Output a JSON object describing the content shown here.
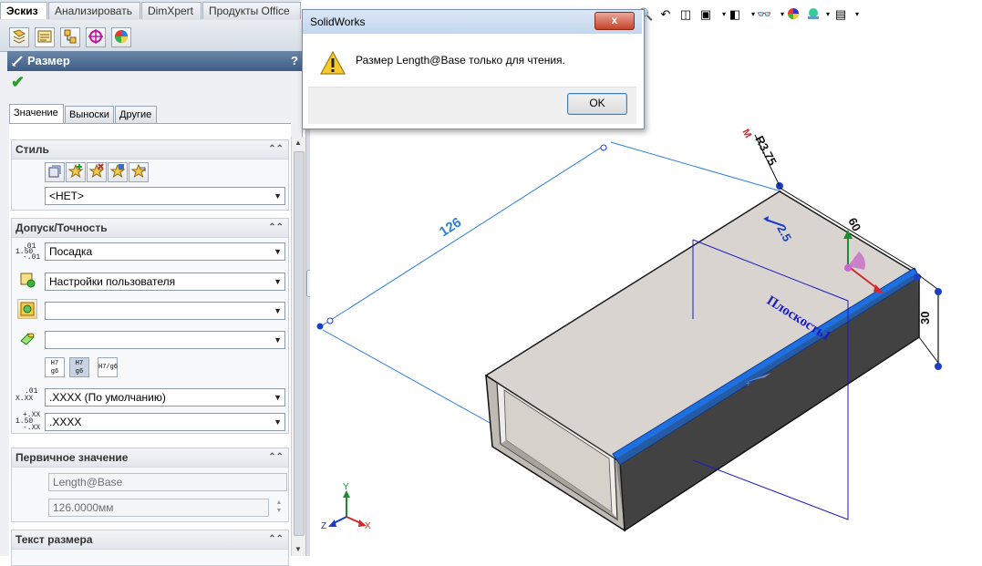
{
  "command_tabs": [
    "Эскиз",
    "Анализировать",
    "DimXpert",
    "Продукты Office"
  ],
  "manager_icons": [
    "feature-manager-icon",
    "property-manager-icon",
    "configuration-manager-icon",
    "dimxpert-manager-icon",
    "display-manager-icon"
  ],
  "property_manager": {
    "title": "Размер",
    "help": "?",
    "tabs": [
      "Значение",
      "Выноски",
      "Другие"
    ],
    "style": {
      "header": "Стиль",
      "select_value": "<НЕТ>"
    },
    "tolerance": {
      "header": "Допуск/Точность",
      "tol_type_label_top": ".01",
      "tol_type_label_mid": "1.50",
      "tol_type_label_bot": "-.01",
      "tolerance_type": "Посадка",
      "classification": "Настройки пользователя",
      "hole_fit": "",
      "shaft_fit": "",
      "fit_buttons": [
        "H7/g6 stacked",
        "H7/g6 stacked on",
        "H7/g6 linear"
      ],
      "fit_texts": [
        [
          "H7",
          "g6"
        ],
        [
          "H7",
          "g6"
        ],
        [
          "H7/g6"
        ]
      ],
      "primary_precision_icon_top": ".01",
      "primary_precision_icon_bot": "X.XX",
      "primary_precision": ".XXXX (По умолчанию)",
      "tol_precision_icon_top": "+.XX",
      "tol_precision_icon_mid": "1.50",
      "tol_precision_icon_bot": "-.XX",
      "tolerance_precision": ".XXXX"
    },
    "primary_value": {
      "header": "Первичное значение",
      "name": "Length@Base",
      "value": "126.0000мм"
    },
    "dimension_text": {
      "header": "Текст размера"
    }
  },
  "dialog": {
    "title": "SolidWorks",
    "close_label": "x",
    "message": "Размер Length@Base только для чтения.",
    "ok_label": "OK"
  },
  "viewport": {
    "dim_126": "126",
    "dim_radius": "R3.75",
    "dim_radius_prefix": "M",
    "dim_2_5": "2.5",
    "dim_60": "60",
    "dim_30": "30",
    "plane_label": "Плоскость1",
    "axis_x": "X",
    "axis_y": "Y",
    "axis_z": "Z",
    "colors": {
      "selection_blue": "#1e6fe0",
      "dim_line_blue": "#2f7fe0",
      "plane_blue": "#1a1acb",
      "part_gray": "#c8c3bd"
    }
  }
}
